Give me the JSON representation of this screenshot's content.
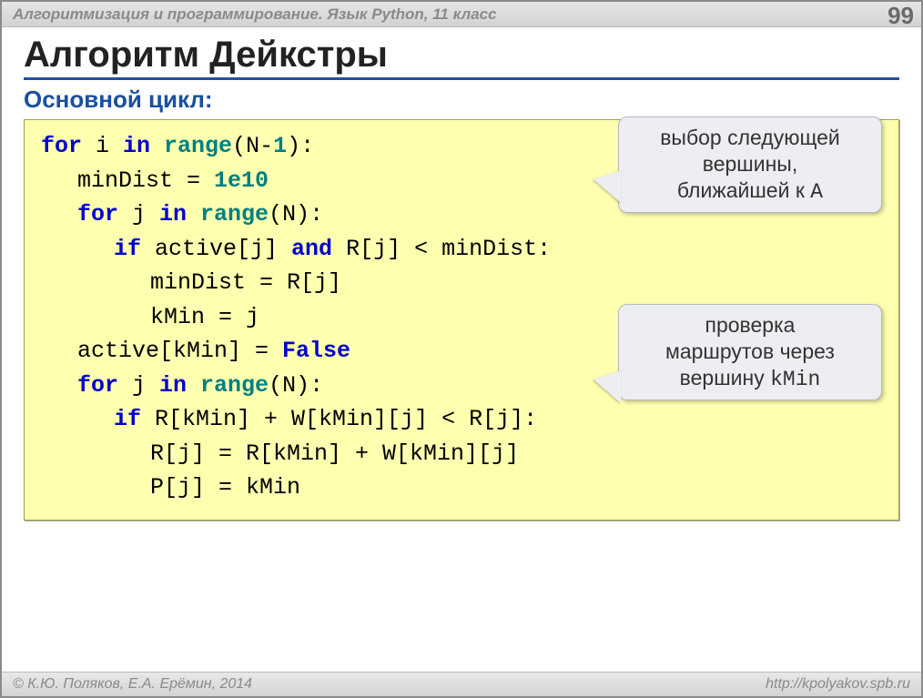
{
  "header": {
    "subject": "Алгоритмизация и программирование. Язык Python, 11 класс",
    "page": "99"
  },
  "title": "Алгоритм Дейкстры",
  "section": "Основной цикл:",
  "code": {
    "l1": {
      "kw1": "for",
      "a": " i ",
      "kw2": "in",
      "fn": " range",
      "b": "(N-",
      "one": "1",
      "c": "):"
    },
    "l2": {
      "a": "minDist = ",
      "v": "1e10"
    },
    "l3": {
      "kw1": "for",
      "a": " j ",
      "kw2": "in",
      "fn": " range",
      "b": "(N):"
    },
    "l4": {
      "kw1": "if",
      "a": " active[j] ",
      "kw2": "and",
      "b": " R[j] < minDist:"
    },
    "l5": "minDist = R[j]",
    "l6": "kMin = j",
    "l7": {
      "a": "active[kMin] = ",
      "v": "False"
    },
    "l8": {
      "kw1": "for",
      "a": " j ",
      "kw2": "in",
      "fn": " range",
      "b": "(N):"
    },
    "l9": {
      "kw1": "if",
      "a": " R[kMin] + W[kMin][j] < R[j]:"
    },
    "l10": "R[j] = R[kMin] + W[kMin][j]",
    "l11": "P[j] = kMin"
  },
  "callouts": {
    "c1": {
      "l1": "выбор следующей",
      "l2": "вершины,",
      "l3a": "ближайшей к ",
      "l3m": "A"
    },
    "c2": {
      "l1": "проверка",
      "l2": "маршрутов через",
      "l3a": "вершину ",
      "l3m": "kMin"
    }
  },
  "footer": {
    "authors": "© К.Ю. Поляков, Е.А. Ерёмин, 2014",
    "url": "http://kpolyakov.spb.ru"
  }
}
